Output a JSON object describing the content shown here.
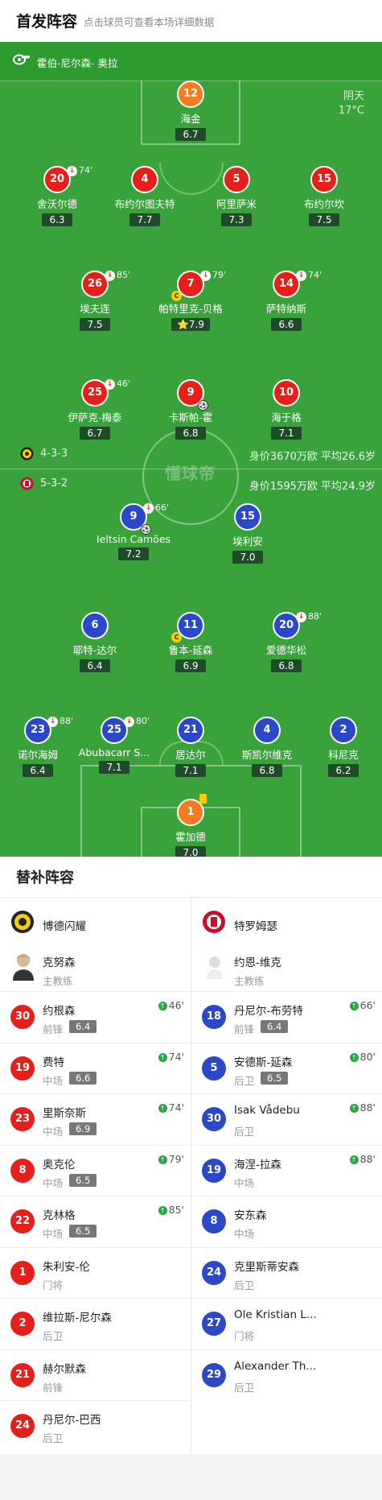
{
  "header": {
    "title": "首发阵容",
    "subtitle": "点击球员可查看本场详细数据"
  },
  "referee": "霍伯-尼尔森- 奥拉",
  "weather": {
    "condition": "阴天",
    "temp": "17°C"
  },
  "home": {
    "formation": "4-3-3",
    "value": "身价3670万欧 平均26.6岁"
  },
  "away": {
    "formation": "5-3-2",
    "value": "身价1595万欧 平均24.9岁"
  },
  "watermark": "懂球帝",
  "home_players": [
    {
      "num": "12",
      "name": "海金",
      "rating": "6.7"
    },
    {
      "num": "20",
      "name": "舍沃尔德",
      "rating": "6.3",
      "sub": "74'"
    },
    {
      "num": "4",
      "name": "布约尔图夫特",
      "rating": "7.7"
    },
    {
      "num": "5",
      "name": "阿里萨米",
      "rating": "7.3"
    },
    {
      "num": "15",
      "name": "布约尔坎",
      "rating": "7.5"
    },
    {
      "num": "26",
      "name": "埃夫连",
      "rating": "7.5",
      "sub": "85'"
    },
    {
      "num": "7",
      "name": "帕特里克-贝格",
      "rating": "⭐7.9",
      "sub": "79'",
      "captain": "C"
    },
    {
      "num": "14",
      "name": "萨特纳斯",
      "rating": "6.6",
      "sub": "74'"
    },
    {
      "num": "25",
      "name": "伊萨克-梅泰",
      "rating": "6.7",
      "sub": "46'"
    },
    {
      "num": "9",
      "name": "卡斯帕-霍",
      "rating": "6.8",
      "goal": "⚽"
    },
    {
      "num": "10",
      "name": "海于格",
      "rating": "7.1"
    }
  ],
  "away_players": [
    {
      "num": "9",
      "name": "Ieltsin Camões",
      "rating": "7.2",
      "sub": "66'",
      "goal": "⚽"
    },
    {
      "num": "15",
      "name": "埃利安",
      "rating": "7.0"
    },
    {
      "num": "6",
      "name": "耶特-达尔",
      "rating": "6.4"
    },
    {
      "num": "11",
      "name": "鲁本-延森",
      "rating": "6.9",
      "captain": "C"
    },
    {
      "num": "20",
      "name": "爱德华松",
      "rating": "6.8",
      "sub": "88'"
    },
    {
      "num": "23",
      "name": "诺尔海姆",
      "rating": "6.4",
      "sub": "88'"
    },
    {
      "num": "25",
      "name": "Abubacarr S...",
      "rating": "7.1",
      "sub": "80'"
    },
    {
      "num": "21",
      "name": "居达尔",
      "rating": "7.1"
    },
    {
      "num": "4",
      "name": "斯凯尔维克",
      "rating": "6.8"
    },
    {
      "num": "2",
      "name": "科尼克",
      "rating": "6.2"
    },
    {
      "num": "1",
      "name": "霍加德",
      "rating": "7.0"
    }
  ],
  "bench": {
    "title": "替补阵容",
    "home_team": "博德闪耀",
    "away_team": "特罗姆瑟",
    "home_coach": {
      "name": "克努森",
      "role": "主教练"
    },
    "away_coach": {
      "name": "约恩-维克",
      "role": "主教练"
    },
    "home_subs": [
      {
        "num": "30",
        "name": "约根森",
        "pos": "前锋",
        "rating": "6.4",
        "time": "46'"
      },
      {
        "num": "19",
        "name": "费特",
        "pos": "中场",
        "rating": "6.6",
        "time": "74'"
      },
      {
        "num": "23",
        "name": "里斯奈斯",
        "pos": "中场",
        "rating": "6.9",
        "time": "74'"
      },
      {
        "num": "8",
        "name": "奥克伦",
        "pos": "中场",
        "rating": "6.5",
        "time": "79'"
      },
      {
        "num": "22",
        "name": "克林格",
        "pos": "中场",
        "rating": "6.5",
        "time": "85'"
      },
      {
        "num": "1",
        "name": "朱利安-伦",
        "pos": "门将"
      },
      {
        "num": "2",
        "name": "维拉斯-尼尔森",
        "pos": "后卫"
      },
      {
        "num": "21",
        "name": "赫尔默森",
        "pos": "前锋"
      },
      {
        "num": "24",
        "name": "丹尼尔-巴西",
        "pos": "后卫"
      }
    ],
    "away_subs": [
      {
        "num": "18",
        "name": "丹尼尔-布劳特",
        "pos": "前锋",
        "rating": "6.4",
        "time": "66'"
      },
      {
        "num": "5",
        "name": "安德斯-延森",
        "pos": "后卫",
        "rating": "6.5",
        "time": "80'"
      },
      {
        "num": "30",
        "name": "Isak Vådebu",
        "pos": "后卫",
        "time": "88'"
      },
      {
        "num": "19",
        "name": "海涅-拉森",
        "pos": "中场",
        "time": "88'"
      },
      {
        "num": "8",
        "name": "安东森",
        "pos": "中场"
      },
      {
        "num": "24",
        "name": "克里斯蒂安森",
        "pos": "后卫"
      },
      {
        "num": "27",
        "name": "Ole Kristian L...",
        "pos": "门将"
      },
      {
        "num": "29",
        "name": "Alexander Th...",
        "pos": "后卫"
      }
    ]
  },
  "colors": {
    "pitch": "#3aa23a",
    "home": "#e5201b",
    "away": "#2a48c8",
    "keeper_away": "#f47b20"
  }
}
